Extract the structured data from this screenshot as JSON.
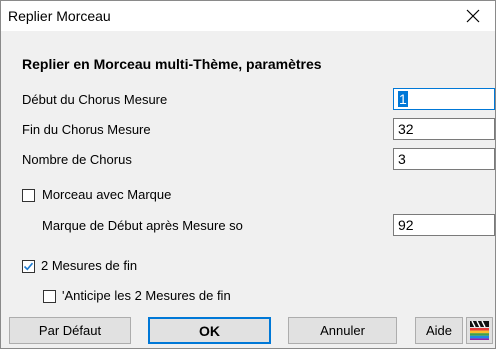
{
  "window": {
    "title": "Replier Morceau"
  },
  "heading": "Replier en Morceau multi-Thème, paramètres",
  "fields": {
    "debut_label": "Début du Chorus Mesure",
    "debut_value": "1",
    "fin_label": "Fin du Chorus Mesure",
    "fin_value": "32",
    "nombre_label": "Nombre de Chorus",
    "nombre_value": "3",
    "marque_label": "Marque de Début après Mesure so",
    "marque_value": "92"
  },
  "checkboxes": {
    "morceau_marque": {
      "label": "Morceau avec Marque",
      "checked": false
    },
    "deux_mesures": {
      "label": "2 Mesures de fin",
      "checked": true
    },
    "anticipe": {
      "label": "'Anticipe les 2 Mesures de fin",
      "checked": false
    }
  },
  "buttons": {
    "par_defaut": "Par Défaut",
    "ok": "OK",
    "annuler": "Annuler",
    "aide": "Aide"
  },
  "icons": {
    "close": "close-icon",
    "clapperboard": "clapperboard-icon"
  },
  "colors": {
    "focus": "#0078d7",
    "check": "#1e7bd0"
  }
}
